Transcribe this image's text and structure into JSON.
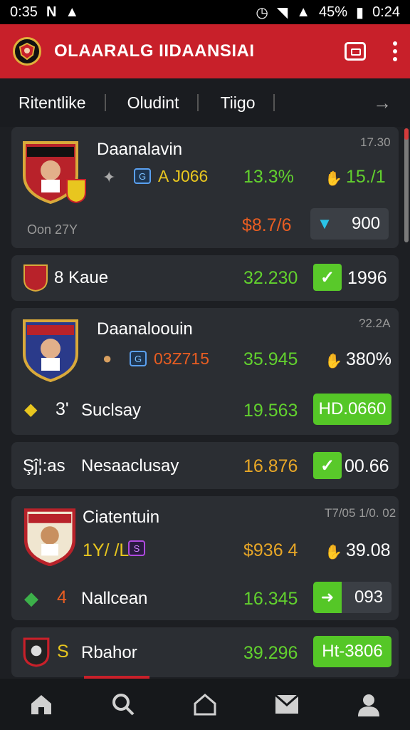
{
  "status_bar": {
    "time_left": "0:35",
    "battery": "45%",
    "time_right": "0:24"
  },
  "app": {
    "title": "OLAARALG IIDAANSIAI",
    "brand_color": "#c8202a"
  },
  "tabs": [
    "Ritentlike",
    "Oludint",
    "Tiigo"
  ],
  "cards": [
    {
      "name": "Daanalavin",
      "corner": "17.30",
      "code": "A J066",
      "value1": "13.3%",
      "value2": "15./1",
      "meta": "Oon 27Y",
      "price": "$8.7/6",
      "last": "900"
    },
    {
      "name": "8 Kaue",
      "value": "32.230",
      "result": "1996"
    },
    {
      "name": "Daanaloouin",
      "corner": "?2.2A",
      "code": "03Z715",
      "value1": "35.945",
      "value2": "380%",
      "sub_prefix": "3'",
      "sub_name": "Suclsay",
      "sub_value": "19.563",
      "sub_result": "HD.0660"
    },
    {
      "prefix": "Şĵ¦:as",
      "name": "Nesaaclusay",
      "value": "16.876",
      "result": "00.66"
    },
    {
      "name": "Ciatentuin",
      "corner": "T7/05 1/0. 02",
      "code": "1Y/ /L",
      "price": "$936 4",
      "value2": "39.08",
      "sub_prefix": "4",
      "sub_name": "Nallcean",
      "sub_value": "16.345",
      "sub_result": "093"
    },
    {
      "prefix": "S",
      "name": "Rbahor",
      "value": "39.296",
      "result": "Ht-3806"
    }
  ],
  "icons": {
    "menu": "kebab-icon",
    "bottom_nav": [
      "home-icon",
      "search-icon",
      "house-icon",
      "mail-icon",
      "profile-icon"
    ]
  }
}
